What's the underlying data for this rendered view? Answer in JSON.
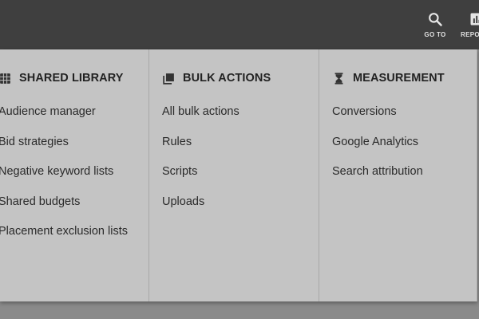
{
  "toolbar": {
    "goto_label": "GO TO",
    "reports_label": "REPORTS",
    "goto_icon": "search-icon",
    "reports_icon": "bar-chart-icon"
  },
  "menu": {
    "shared_library": {
      "title": "SHARED LIBRARY",
      "icon": "grid-icon",
      "items": [
        "Audience manager",
        "Bid strategies",
        "Negative keyword lists",
        "Shared budgets",
        "Placement exclusion lists"
      ]
    },
    "bulk_actions": {
      "title": "BULK ACTIONS",
      "icon": "copy-stack-icon",
      "items": [
        "All bulk actions",
        "Rules",
        "Scripts",
        "Uploads"
      ]
    },
    "measurement": {
      "title": "MEASUREMENT",
      "icon": "hourglass-icon",
      "items": [
        "Conversions",
        "Google Analytics",
        "Search attribution"
      ]
    }
  }
}
